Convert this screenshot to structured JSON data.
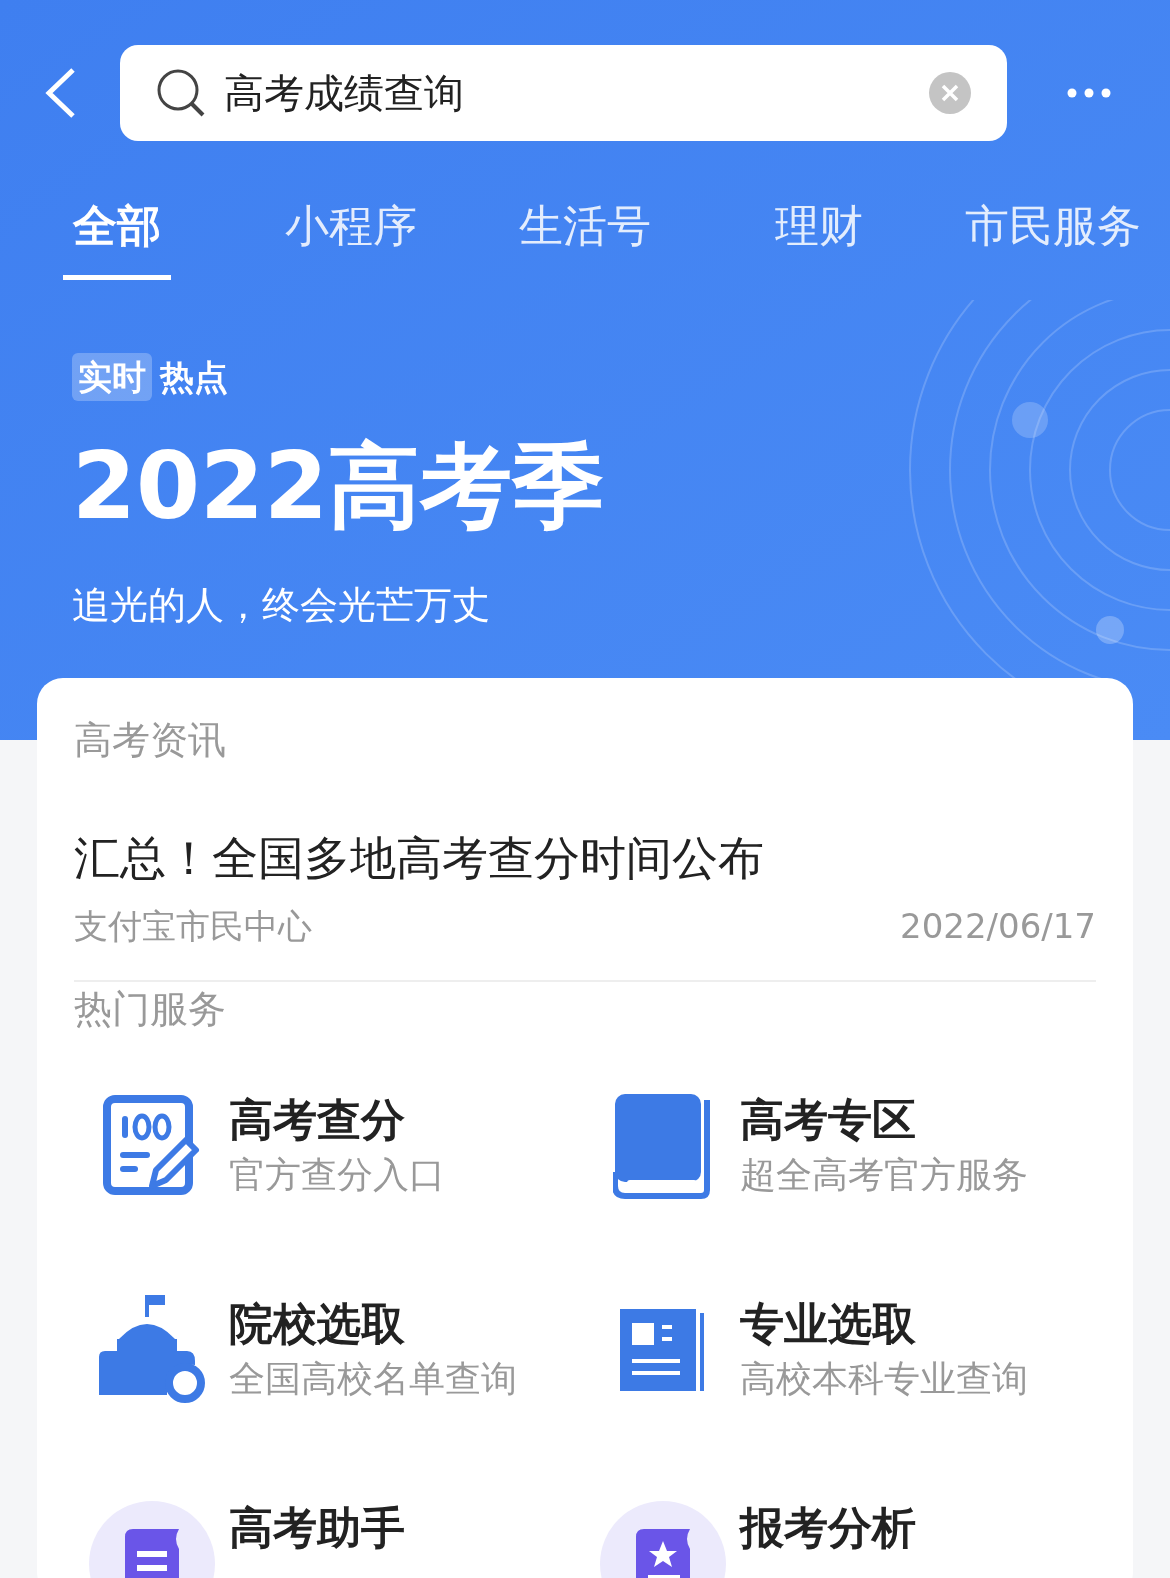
{
  "search": {
    "value": "高考成绩查询"
  },
  "tabs": [
    {
      "label": "全部",
      "selected": true
    },
    {
      "label": "小程序",
      "selected": false
    },
    {
      "label": "生活号",
      "selected": false
    },
    {
      "label": "理财",
      "selected": false
    },
    {
      "label": "市民服务",
      "selected": false
    }
  ],
  "banner": {
    "badge": "实时",
    "badge_label": "热点",
    "title": "2022高考季",
    "subtitle": "追光的人，终会光芒万丈"
  },
  "news": {
    "section": "高考资讯",
    "headline": "汇总！全国多地高考查分时间公布",
    "source": "支付宝市民中心",
    "date": "2022/06/17"
  },
  "services": {
    "section": "热门服务",
    "items": [
      {
        "kind": "score",
        "title": "高考查分",
        "subtitle": "官方查分入口"
      },
      {
        "kind": "book",
        "title": "高考专区",
        "subtitle": "超全高考官方服务"
      },
      {
        "kind": "school",
        "title": "院校选取",
        "subtitle": "全国高校名单查询"
      },
      {
        "kind": "news",
        "title": "专业选取",
        "subtitle": "高校本科专业查询"
      },
      {
        "kind": "scroll",
        "title": "高考助手"
      },
      {
        "kind": "star",
        "title": "报考分析"
      }
    ]
  }
}
